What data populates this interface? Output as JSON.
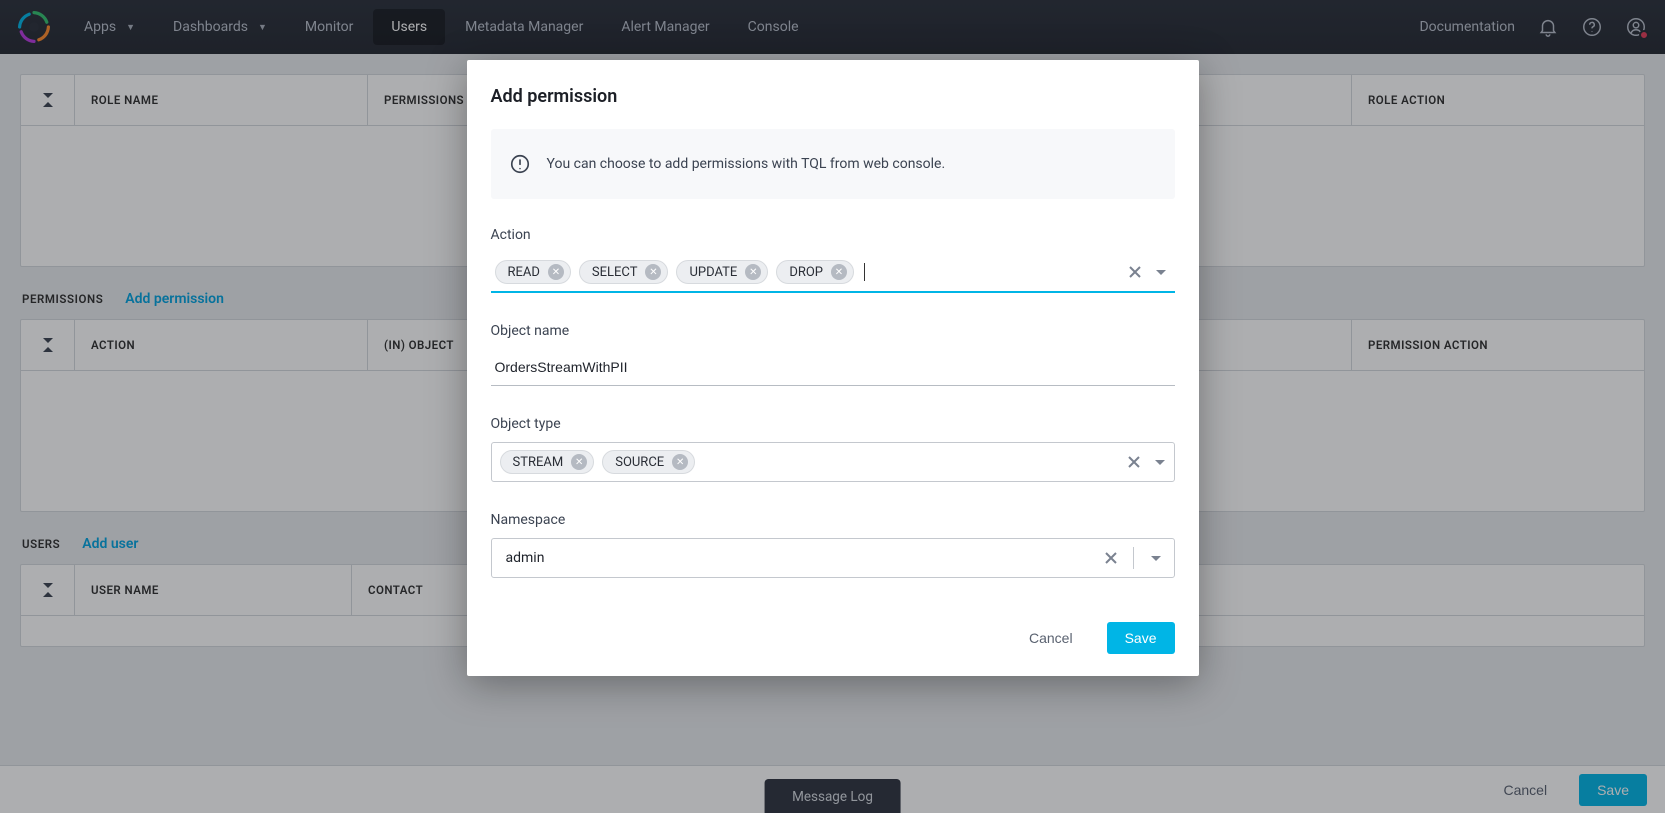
{
  "nav": {
    "items": [
      {
        "label": "Apps",
        "hasCaret": true
      },
      {
        "label": "Dashboards",
        "hasCaret": true
      },
      {
        "label": "Monitor"
      },
      {
        "label": "Users",
        "active": true
      },
      {
        "label": "Metadata Manager"
      },
      {
        "label": "Alert Manager"
      },
      {
        "label": "Console"
      }
    ],
    "doc_label": "Documentation"
  },
  "grids": {
    "roles": {
      "cols": {
        "role_name": "ROLE NAME",
        "permissions": "PERMISSIONS",
        "role_action": "ROLE ACTION"
      }
    },
    "permissions_section": {
      "title": "PERMISSIONS",
      "add_label": "Add permission",
      "cols": {
        "action": "ACTION",
        "in_object": "(IN) OBJECT",
        "permission_action": "PERMISSION ACTION"
      }
    },
    "users_section": {
      "title": "USERS",
      "add_label": "Add user",
      "cols": {
        "user_name": "USER NAME",
        "contact": "CONTACT"
      }
    }
  },
  "footer": {
    "cancel": "Cancel",
    "save": "Save",
    "message_log": "Message Log"
  },
  "modal": {
    "title": "Add permission",
    "notice": "You can choose to add permissions with TQL from web console.",
    "fields": {
      "action": {
        "label": "Action",
        "chips": [
          "READ",
          "SELECT",
          "UPDATE",
          "DROP"
        ]
      },
      "object_name": {
        "label": "Object name",
        "value": "OrdersStreamWithPII"
      },
      "object_type": {
        "label": "Object type",
        "chips": [
          "STREAM",
          "SOURCE"
        ]
      },
      "namespace": {
        "label": "Namespace",
        "value": "admin"
      }
    },
    "cancel": "Cancel",
    "save": "Save"
  }
}
